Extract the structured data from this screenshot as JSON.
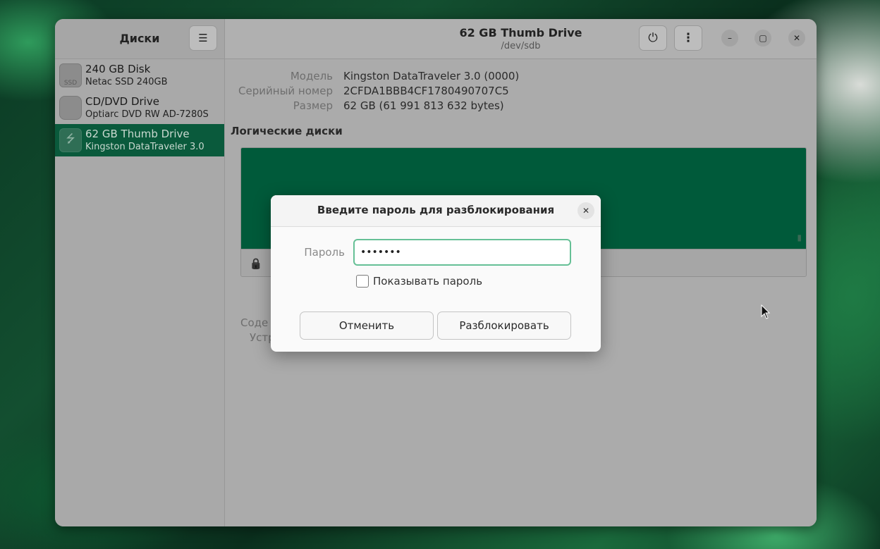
{
  "sidebar": {
    "title": "Диски",
    "devices": [
      {
        "title": "240 GB Disk",
        "subtitle": "Netac SSD 240GB",
        "icon": "ssd-icon",
        "icon_text": "SSD"
      },
      {
        "title": "CD/DVD Drive",
        "subtitle": "Optiarc DVD RW AD-7280S",
        "icon": "optical-drive-icon",
        "icon_text": ""
      },
      {
        "title": "62 GB Thumb Drive",
        "subtitle": "Kingston DataTraveler 3.0",
        "icon": "usb-icon",
        "icon_text": "⭍"
      }
    ],
    "selected_index": 2
  },
  "header": {
    "title": "62 GB Thumb Drive",
    "subtitle": "/dev/sdb",
    "menu_icon": "☰",
    "power_icon": "⏻",
    "more_icon": "⋮",
    "minimize_icon": "–",
    "maximize_icon": "▢",
    "close_icon": "✕"
  },
  "details": {
    "model_label": "Модель",
    "model_value": "Kingston DataTraveler 3.0 (0000)",
    "serial_label": "Серийный номер",
    "serial_value": "2CFDA1BBB4CF1780490707C5",
    "size_label": "Размер",
    "size_value": "62 GB (61 991 813 632 bytes)"
  },
  "volumes": {
    "title": "Логические диски",
    "lock_icon": "🔒",
    "content_label_partial": "Соде",
    "device_label_partial": "Устр"
  },
  "dialog": {
    "title": "Введите пароль для разблокирования",
    "close_icon": "✕",
    "password_label": "Пароль",
    "password_value": "•••••••",
    "show_password_label": "Показывать пароль",
    "cancel_label": "Отменить",
    "unlock_label": "Разблокировать"
  },
  "colors": {
    "accent": "#005a3a",
    "selection": "#0a5a3c",
    "focus_ring": "#66c096"
  }
}
